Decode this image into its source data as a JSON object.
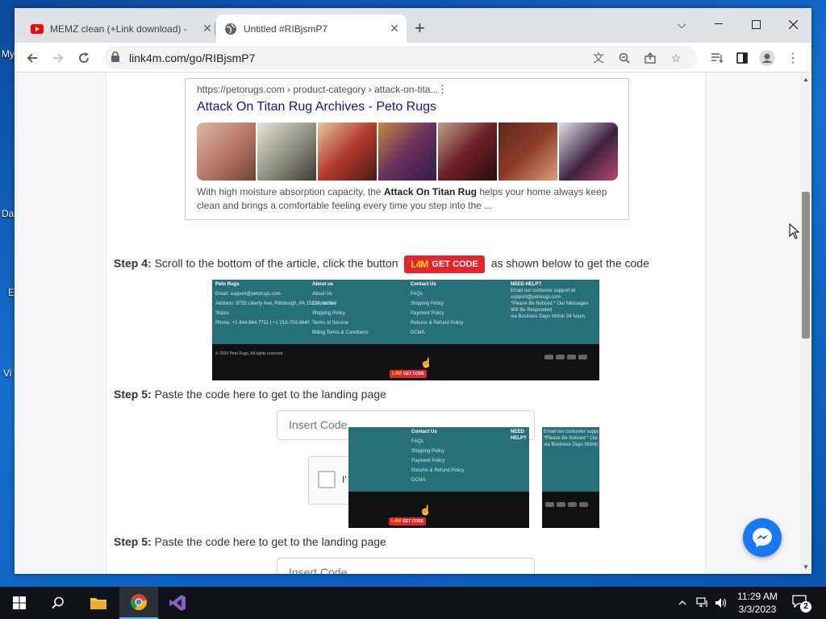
{
  "desktop": {
    "icon_labels": [
      "My",
      "Da",
      "E",
      "Vi"
    ]
  },
  "browser": {
    "tabs": [
      {
        "title": "MEMZ clean (+Link download) -",
        "favicon": "youtube-icon"
      },
      {
        "title": "Untitled #RIBjsmP7",
        "favicon": "globe-icon"
      }
    ],
    "new_tab_label": "+",
    "url": "link4m.com/go/RIBjsmP7"
  },
  "page": {
    "search_result": {
      "breadcrumb": "https://petorugs.com › product-category › attack-on-tita...",
      "title": "Attack On Titan Rug Archives - Peto Rugs",
      "desc_before": "With high moisture absorption capacity, the ",
      "desc_bold": "Attack On Titan Rug",
      "desc_after": " helps your home always keep clean and brings a comfortable feeling every time you step into the ...",
      "thumb_colors": [
        "#b97a6a",
        "#8c8c80",
        "#b3392c",
        "#6a2f5c",
        "#6b1f24",
        "#8f3b2a",
        "#3b2340"
      ]
    },
    "step4": {
      "label": "Step 4:",
      "text_before": " Scroll to the bottom of the article, click the button",
      "button_logo": "L4M",
      "button_text": "GET CODE",
      "text_after": "as shown below to get the code"
    },
    "footer_image": {
      "col1_title": "Peto Rugs",
      "col1_lines": [
        "Email: support@petorugs.com",
        "Address: 8735 Liberty Ave, Pittsburgh, PA 15224, United",
        "States",
        "Phone: +1 844-844-7711 | +1 213-703-8640"
      ],
      "col2_title": "About us",
      "col2_lines": [
        "About Us",
        "Contact Us",
        "Shipping Policy",
        "Terms of Service",
        "Billing Terms & Conditions"
      ],
      "col3_title": "Contact Us",
      "col3_lines": [
        "FAQs",
        "Shipping Policy",
        "Payment Policy",
        "Returns & Refund Policy",
        "DCMA"
      ],
      "col4_title": "NEED HELP?",
      "col4_lines": [
        "Email our customer support at support@petorugs.com",
        "*Please Be Noticed * Our Messages Will Be Responded",
        "via Business Days Within 24 hours"
      ],
      "copyright": "© 2020 Peto Rugs. All rights reserved",
      "get_code_logo": "L4M",
      "get_code_text": "GET CODE"
    },
    "step5": {
      "label": "Step 5:",
      "text": " Paste the code here to get to the landing page",
      "input_placeholder": "Insert Code"
    },
    "captcha": {
      "label_partial": "I'"
    },
    "step5_repeat": {
      "label": "Step 5:",
      "text": " Paste the code here to get to the landing page",
      "input_placeholder": "Insert Code"
    }
  },
  "taskbar": {
    "time": "11:29 AM",
    "date": "3/3/2023",
    "notification_count": "2"
  }
}
